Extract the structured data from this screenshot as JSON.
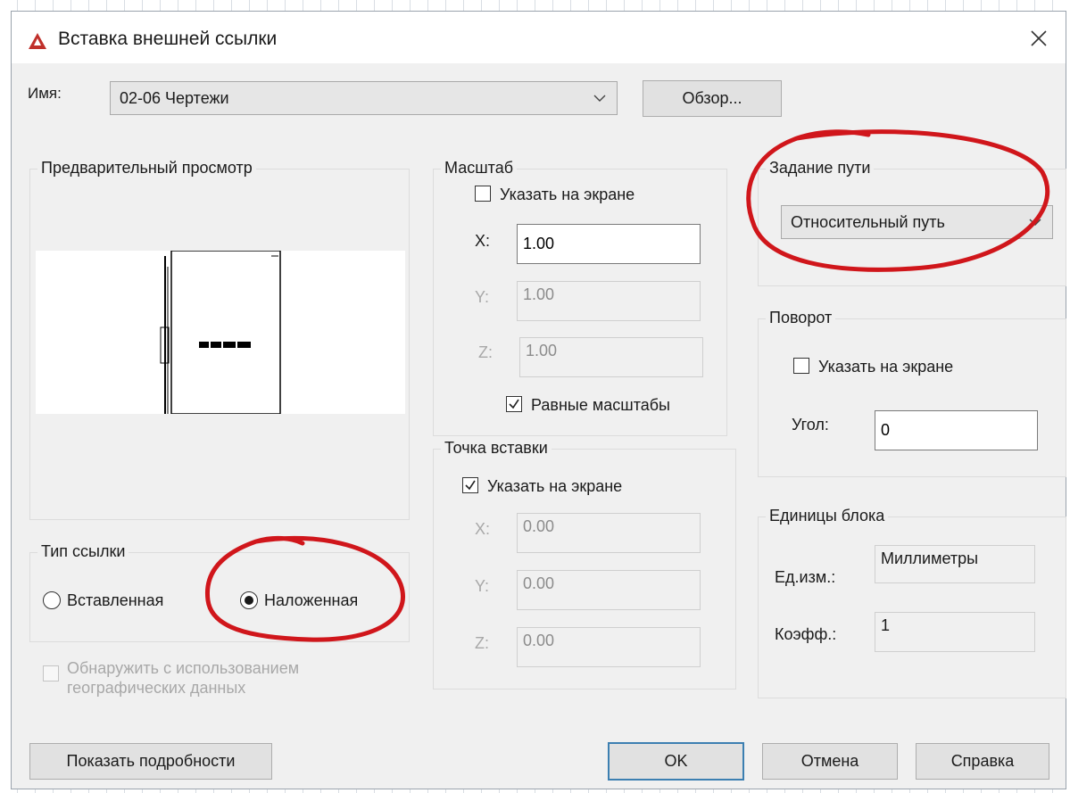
{
  "window": {
    "title": "Вставка внешней ссылки",
    "close_icon": "close-icon",
    "app_icon": "autocad-logo-icon",
    "accent_color": "#c0302b"
  },
  "name_row": {
    "label": "Имя:",
    "value": "02-06 Чертежи",
    "browse_label": "Обзор..."
  },
  "preview": {
    "title": "Предварительный просмотр"
  },
  "scale": {
    "title": "Масштаб",
    "specify_on_screen": "Указать на экране",
    "specify_checked": false,
    "x_label": "X:",
    "x_value": "1.00",
    "y_label": "Y:",
    "y_value": "1.00",
    "z_label": "Z:",
    "z_value": "1.00",
    "uniform_label": "Равные масштабы",
    "uniform_checked": true
  },
  "insertion_point": {
    "title": "Точка вставки",
    "specify_on_screen": "Указать на экране",
    "specify_checked": true,
    "x_label": "X:",
    "x_value": "0.00",
    "y_label": "Y:",
    "y_value": "0.00",
    "z_label": "Z:",
    "z_value": "0.00"
  },
  "path_type": {
    "title": "Задание пути",
    "value": "Относительный путь"
  },
  "rotation": {
    "title": "Поворот",
    "specify_on_screen": "Указать на экране",
    "specify_checked": false,
    "angle_label": "Угол:",
    "angle_value": "0"
  },
  "block_units": {
    "title": "Единицы блока",
    "unit_label": "Ед.изм.:",
    "unit_value": "Миллиметры",
    "factor_label": "Коэфф.:",
    "factor_value": "1"
  },
  "reference_type": {
    "title": "Тип ссылки",
    "attach_label": "Вставленная",
    "overlay_label": "Наложенная",
    "selected": "overlay"
  },
  "geo": {
    "line1": "Обнаружить с использованием",
    "line2": "географических данных"
  },
  "buttons": {
    "details": "Показать подробности",
    "ok": "OK",
    "cancel": "Отмена",
    "help": "Справка"
  },
  "annotation_color": "#d0161b"
}
